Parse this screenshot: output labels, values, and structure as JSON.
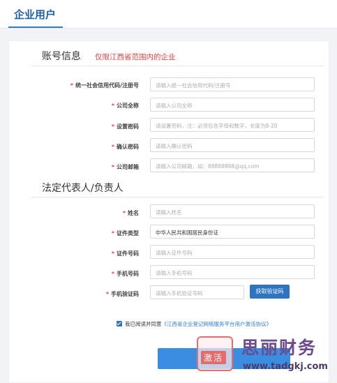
{
  "header": {
    "tab_label": "企业用户"
  },
  "account_section": {
    "title": "账号信息",
    "note": "仅限江西省范围内的企业",
    "fields": [
      {
        "label": "统一社会信用代码/注册号",
        "placeholder": "请输入统一社会信用代码/注册号"
      },
      {
        "label": "公司全称",
        "placeholder": "请输入公司全称"
      },
      {
        "label": "设置密码",
        "placeholder": "请设置密码，注：必须包含字母和数字，长度为8-20"
      },
      {
        "label": "确认密码",
        "placeholder": "请输入确认密码"
      },
      {
        "label": "公司邮箱",
        "placeholder": "请输入公司邮箱，如：88888888@qq.com"
      }
    ]
  },
  "legal_section": {
    "title": "法定代表人/负责人",
    "fields": [
      {
        "label": "姓名",
        "placeholder": "请输入姓名"
      },
      {
        "label": "证件类型",
        "value": "中华人民共和国居民身份证"
      },
      {
        "label": "证件号码",
        "placeholder": "请输入证件号码"
      },
      {
        "label": "手机号码",
        "placeholder": "请输入手机号码"
      },
      {
        "label": "手机验证码",
        "placeholder": "请输入手机验证号码"
      }
    ],
    "get_code_label": "获取验证码"
  },
  "agreement": {
    "checked": true,
    "prefix": "我已阅读并同意",
    "link": "《江西省企业登记网络服务平台用户激活协议》"
  },
  "watermark": {
    "seal_text": "激活",
    "brand": "思丽财务",
    "url": "www.tadgkj.com"
  },
  "colors": {
    "accent": "#2f74c0",
    "required": "#e54242",
    "submit": "#3a8de0"
  }
}
